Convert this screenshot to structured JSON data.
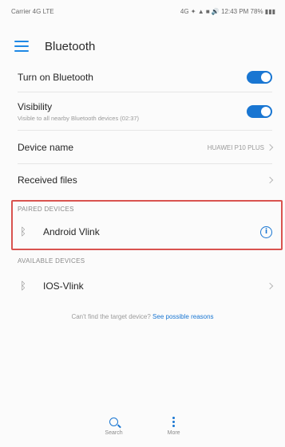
{
  "status_bar": {
    "left": "Carrier 4G LTE",
    "right": "4G ✦ ▲ ■ 🔊 12:43 PM 78% ▮▮▮"
  },
  "app_bar": {
    "title": "Bluetooth"
  },
  "settings": {
    "turn_on": {
      "label": "Turn on Bluetooth",
      "enabled": true
    },
    "visibility": {
      "label": "Visibility",
      "sub": "Visible to all nearby Bluetooth devices (02:37)",
      "enabled": true
    },
    "device_name": {
      "label": "Device name",
      "value": "HUAWEI P10 PLUS"
    },
    "received_files": {
      "label": "Received files"
    }
  },
  "paired": {
    "header": "PAIRED DEVICES",
    "devices": [
      {
        "name": "Android Vlink"
      }
    ]
  },
  "available": {
    "header": "AVAILABLE DEVICES",
    "devices": [
      {
        "name": "IOS-Vlink"
      }
    ]
  },
  "hint": {
    "text": "Can't find the target device? ",
    "link": "See possible reasons"
  },
  "bottom": {
    "search_label": "Search",
    "more_label": "More"
  },
  "colors": {
    "accent": "#1976d2",
    "highlight": "#d9534f"
  }
}
